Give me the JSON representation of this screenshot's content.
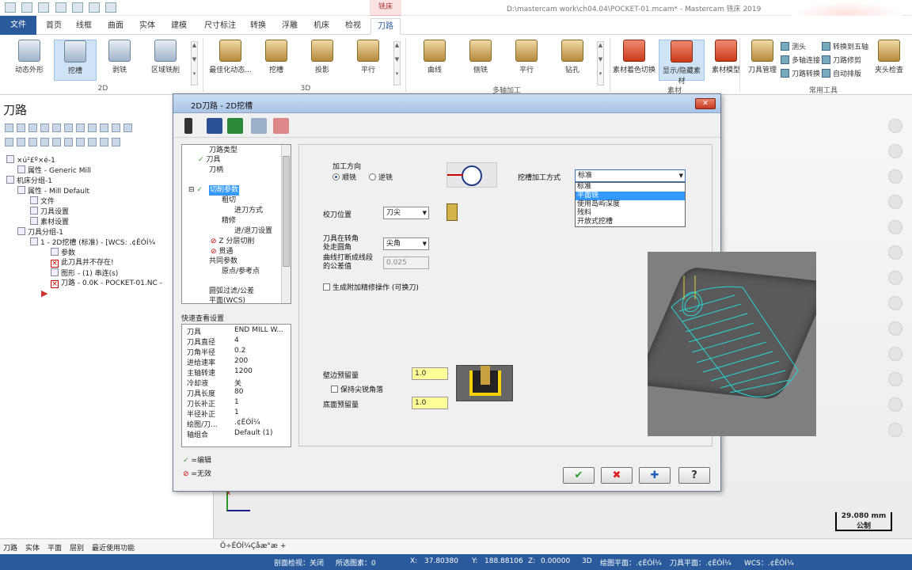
{
  "app": {
    "title": "D:\\mastercam work\\ch04.04\\POCKET-01.mcam* - Mastercam 铣床 2019",
    "context_tab": "铣床"
  },
  "tabs": [
    "文件",
    "首页",
    "线框",
    "曲面",
    "实体",
    "建模",
    "尺寸标注",
    "转换",
    "浮雕",
    "机床",
    "检视",
    "刀路"
  ],
  "ribbon": {
    "g2d": {
      "label": "2D",
      "buttons": [
        "动态外形",
        "挖槽",
        "剥铣",
        "区域铣削"
      ]
    },
    "g3d": {
      "label": "3D",
      "buttons": [
        "最佳化动态...",
        "挖槽",
        "投影",
        "平行"
      ]
    },
    "gmulti": {
      "label": "多轴加工",
      "buttons": [
        "曲线",
        "侧铣",
        "平行",
        "钻孔"
      ]
    },
    "gstock": {
      "label": "素材",
      "buttons": [
        "素材着色切换",
        "显示/隐藏素材",
        "素材模型"
      ]
    },
    "gtools": {
      "label": "常用工具",
      "main": "刀具管理",
      "small": [
        "测头",
        "多轴连接",
        "刀路转换",
        "转换到五轴",
        "刀路修剪",
        "自动排版"
      ],
      "last": "夹头检查"
    }
  },
  "left": {
    "title": "刀路",
    "tree": [
      "×ú²£º×é-1",
      "属性 - Generic Mill",
      "机床分组-1",
      "属性 - Mill Default",
      "文件",
      "刀具设置",
      "素材设置",
      "刀具分组-1",
      "1 - 2D挖槽 (标准) - [WCS: .¢ÊÓÍ¼",
      "参数",
      "此刀具并不存在!",
      "图形 - (1) 串连(s)",
      "刀路 - 0.0K - POCKET-01.NC -"
    ],
    "bottom_tabs": [
      "刀路",
      "实体",
      "平面",
      "层别",
      "最近使用功能"
    ]
  },
  "viewport": {
    "scale_value": "29.080 mm",
    "scale_unit": "公制",
    "tab": "Ö÷ÊÓÍ¼Çåæ°æ",
    "add_tab": "+"
  },
  "status": {
    "section": "剖面检视：关闭",
    "selected": "所选图素：0",
    "x_label": "X:",
    "x": "37.80380",
    "y_label": "Y:",
    "y": "188.88106",
    "z_label": "Z:",
    "z": "0.00000",
    "mode": "3D",
    "plane1": "绘图平面：.¢ÊÓÍ¼",
    "plane2": "刀具平面：.¢ÊÓÍ¼",
    "wcs": "WCS：.¢ÊÓÍ¼"
  },
  "dialog": {
    "title": "2D刀路 - 2D挖槽",
    "nav": [
      "刀路类型",
      "刀具",
      "刀柄",
      "切削参数",
      "粗切",
      "进刀方式",
      "精修",
      "进/退刀设置",
      "Z 分层切削",
      "贯通",
      "共同参数",
      "原点/参考点",
      "圆弧过滤/公差",
      "平面(WCS)"
    ],
    "qv_title": "快速查看设置",
    "qv": [
      [
        "刀具",
        "END MILL W..."
      ],
      [
        "刀具直径",
        "4"
      ],
      [
        "刀角半径",
        "0.2"
      ],
      [
        "进给速率",
        "200"
      ],
      [
        "主轴转速",
        "1200"
      ],
      [
        "冷却液",
        "关"
      ],
      [
        "刀具长度",
        "80"
      ],
      [
        "刀长补正",
        "1"
      ],
      [
        "半径补正",
        "1"
      ],
      [
        "绘图/刀...",
        ".¢ÊÓÍ¼"
      ],
      [
        "轴组合",
        "Default (1)"
      ]
    ],
    "legend_edit": "=编辑",
    "legend_invalid": "=无效",
    "direction_label": "加工方向",
    "climb": "顺铣",
    "conventional": "逆铣",
    "pocket_type_label": "挖槽加工方式",
    "pocket_type_value": "标准",
    "pocket_type_options": [
      "标准",
      "平面铣",
      "使用岛屿深度",
      "残料",
      "开放式挖槽"
    ],
    "tip_comp_label": "校刀位置",
    "tip_comp_value": "刀尖",
    "corner_label": "刀具在转角\n处走圆角",
    "corner_value": "尖角",
    "tol_label": "曲线打断成线段\n的公差值",
    "tol_value": "0.025",
    "gen_finish": "生成附加精修操作 (可换刀)",
    "wall_stock_label": "壁边预留量",
    "wall_stock": "1.0",
    "keep_sharp": "保持尖锐角落",
    "floor_stock_label": "底面预留量",
    "floor_stock": "1.0",
    "ok": "✔",
    "cancel": "✖",
    "add": "✚",
    "help": "?"
  }
}
